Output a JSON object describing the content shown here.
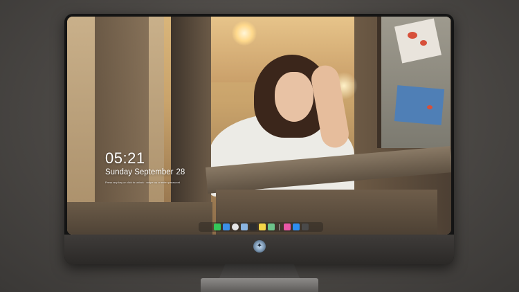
{
  "lock_screen": {
    "time": "05:21",
    "weekday_month": "Sunday September",
    "day": "28",
    "hint": "Press any key or click to unlock · swipe up or enter password"
  },
  "dock": {
    "items": [
      {
        "name": "messages-icon",
        "color": "#34c759"
      },
      {
        "name": "finder-icon",
        "color": "#3b8fe8"
      },
      {
        "name": "safari-icon",
        "color": "#e5e5e5"
      },
      {
        "name": "preview-icon",
        "color": "#8ab4e0"
      },
      {
        "name": "clapper-icon",
        "color": "#2d2d2d"
      },
      {
        "name": "notes-icon",
        "color": "#f5d547"
      },
      {
        "name": "maps-icon",
        "color": "#6cc38a"
      },
      {
        "name": "music-icon",
        "color": "#e957a6"
      },
      {
        "name": "app-store-icon",
        "color": "#2d8ef0"
      },
      {
        "name": "camera-icon",
        "color": "#4a4a4a"
      }
    ]
  },
  "colors": {
    "bezel": "#141414",
    "chin": "#3f3c3a",
    "text": "#ffffff"
  }
}
